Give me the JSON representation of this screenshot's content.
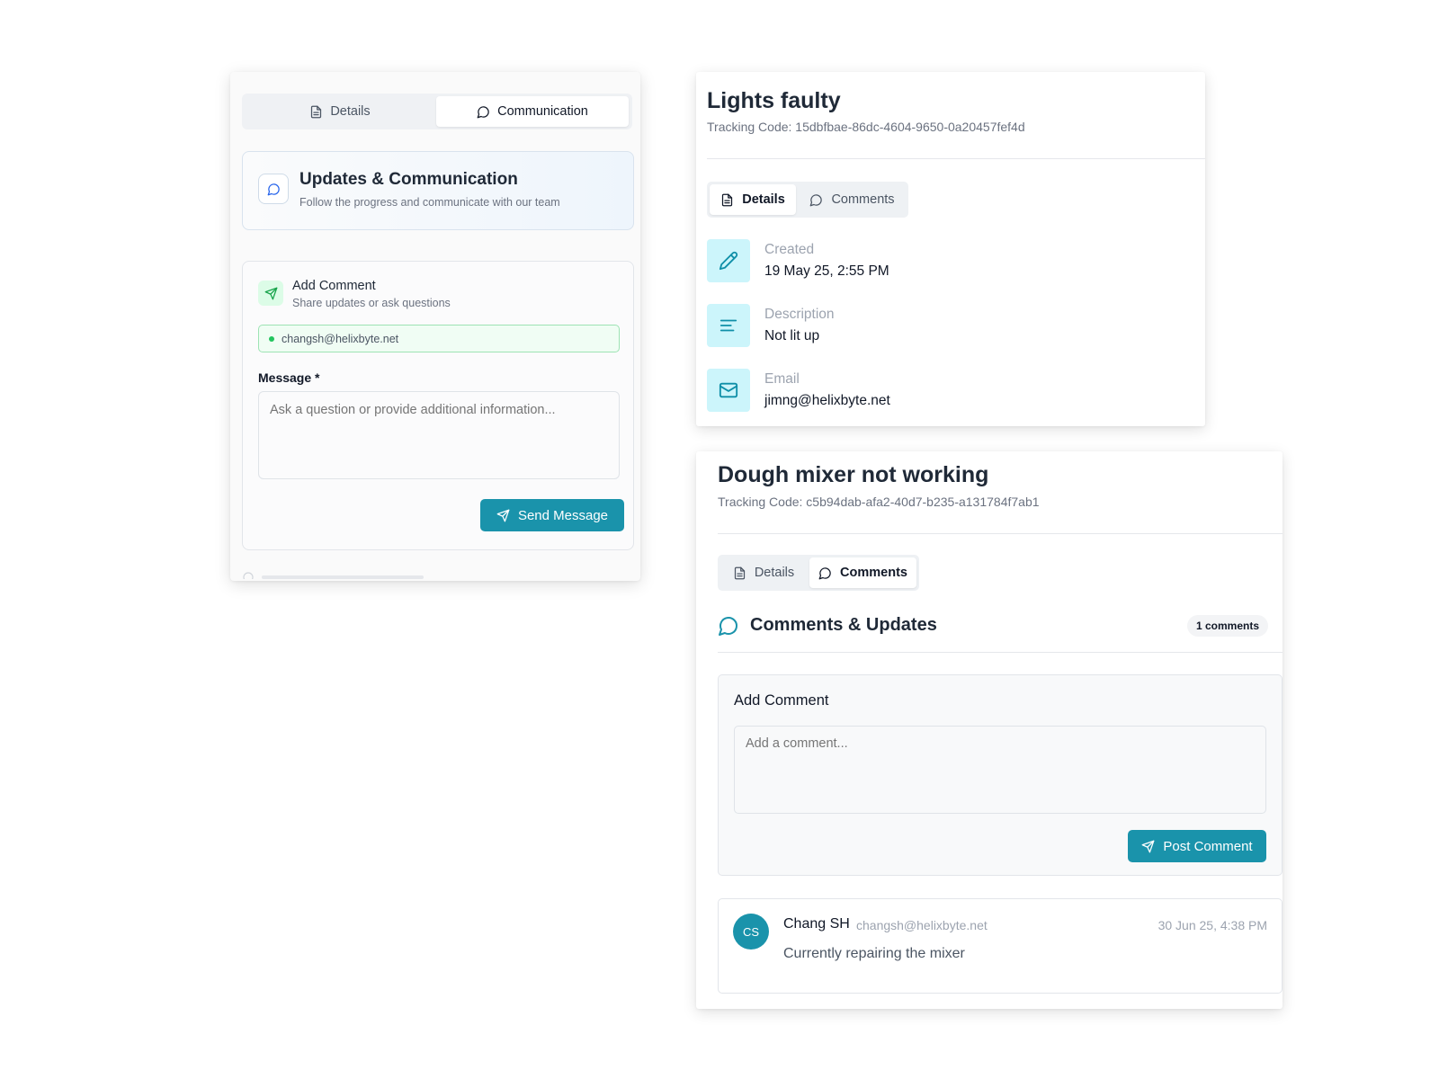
{
  "communication_panel": {
    "tabs": [
      {
        "label": "Details",
        "icon": "file-text-icon",
        "active": false
      },
      {
        "label": "Communication",
        "icon": "message-circle-icon",
        "active": true
      }
    ],
    "header": {
      "title": "Updates & Communication",
      "subtitle": "Follow the progress and communicate with our team",
      "icon": "message-circle-icon"
    },
    "add_comment": {
      "icon": "send-icon",
      "title": "Add Comment",
      "subtitle": "Share updates or ask questions",
      "email": "changsh@helixbyte.net",
      "message_label": "Message *",
      "message_placeholder": "Ask a question or provide additional information...",
      "send_label": "Send Message"
    }
  },
  "ticket_lights": {
    "title": "Lights faulty",
    "tracking": "Tracking Code: 15dbfbae-86dc-4604-9650-0a20457fef4d",
    "tabs": [
      {
        "label": "Details",
        "icon": "file-text-icon",
        "active": true
      },
      {
        "label": "Comments",
        "icon": "message-circle-icon",
        "active": false
      }
    ],
    "fields": [
      {
        "icon": "pencil-icon",
        "label": "Created",
        "value": "19 May 25, 2:55 PM"
      },
      {
        "icon": "align-left-icon",
        "label": "Description",
        "value": "Not lit up"
      },
      {
        "icon": "mail-icon",
        "label": "Email",
        "value": "jimng@helixbyte.net"
      }
    ]
  },
  "ticket_mixer": {
    "title": "Dough mixer not working",
    "tracking": "Tracking Code: c5b94dab-afa2-40d7-b235-a131784f7ab1",
    "tabs": [
      {
        "label": "Details",
        "icon": "file-text-icon",
        "active": false
      },
      {
        "label": "Comments",
        "icon": "message-circle-icon",
        "active": true
      }
    ],
    "comments_header": {
      "title": "Comments & Updates",
      "count": "1 comments",
      "icon": "message-circle-icon"
    },
    "add_comment": {
      "title": "Add Comment",
      "placeholder": "Add a comment...",
      "post_label": "Post Comment"
    },
    "comments": [
      {
        "initials": "CS",
        "name": "Chang SH",
        "email": "changsh@helixbyte.net",
        "time": "30 Jun 25, 4:38 PM",
        "text": "Currently repairing the mixer"
      }
    ]
  },
  "colors": {
    "accent": "#1a93ab",
    "icon_tile": "#ccf5fb",
    "success": "#22c55e",
    "success_bg": "#f0fdf4"
  }
}
